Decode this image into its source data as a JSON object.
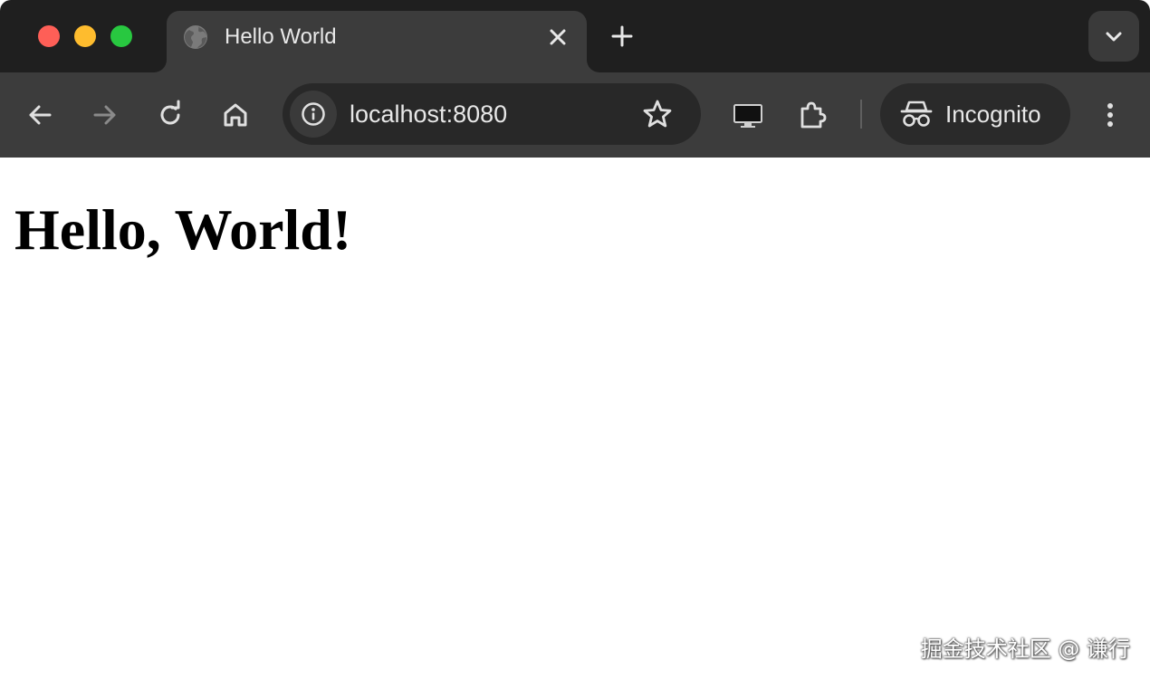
{
  "tab": {
    "title": "Hello World",
    "favicon": "globe-icon"
  },
  "toolbar": {
    "back_icon": "arrow-left-icon",
    "forward_icon": "arrow-right-icon",
    "reload_icon": "reload-icon",
    "home_icon": "home-icon",
    "url": "localhost:8080",
    "site_info_icon": "info-icon",
    "bookmark_icon": "star-icon",
    "cast_icon": "monitor-icon",
    "extensions_icon": "puzzle-icon",
    "profile_label": "Incognito",
    "menu_icon": "vertical-dots-icon"
  },
  "page": {
    "heading": "Hello, World!"
  },
  "watermark": "掘金技术社区 @ 谦行",
  "colors": {
    "tabstrip_bg": "#1f1f1f",
    "toolbar_bg": "#3c3c3c",
    "omnibox_bg": "#282828",
    "close_red": "#fe5f57",
    "minimize_yellow": "#febc2e",
    "zoom_green": "#28c840"
  }
}
